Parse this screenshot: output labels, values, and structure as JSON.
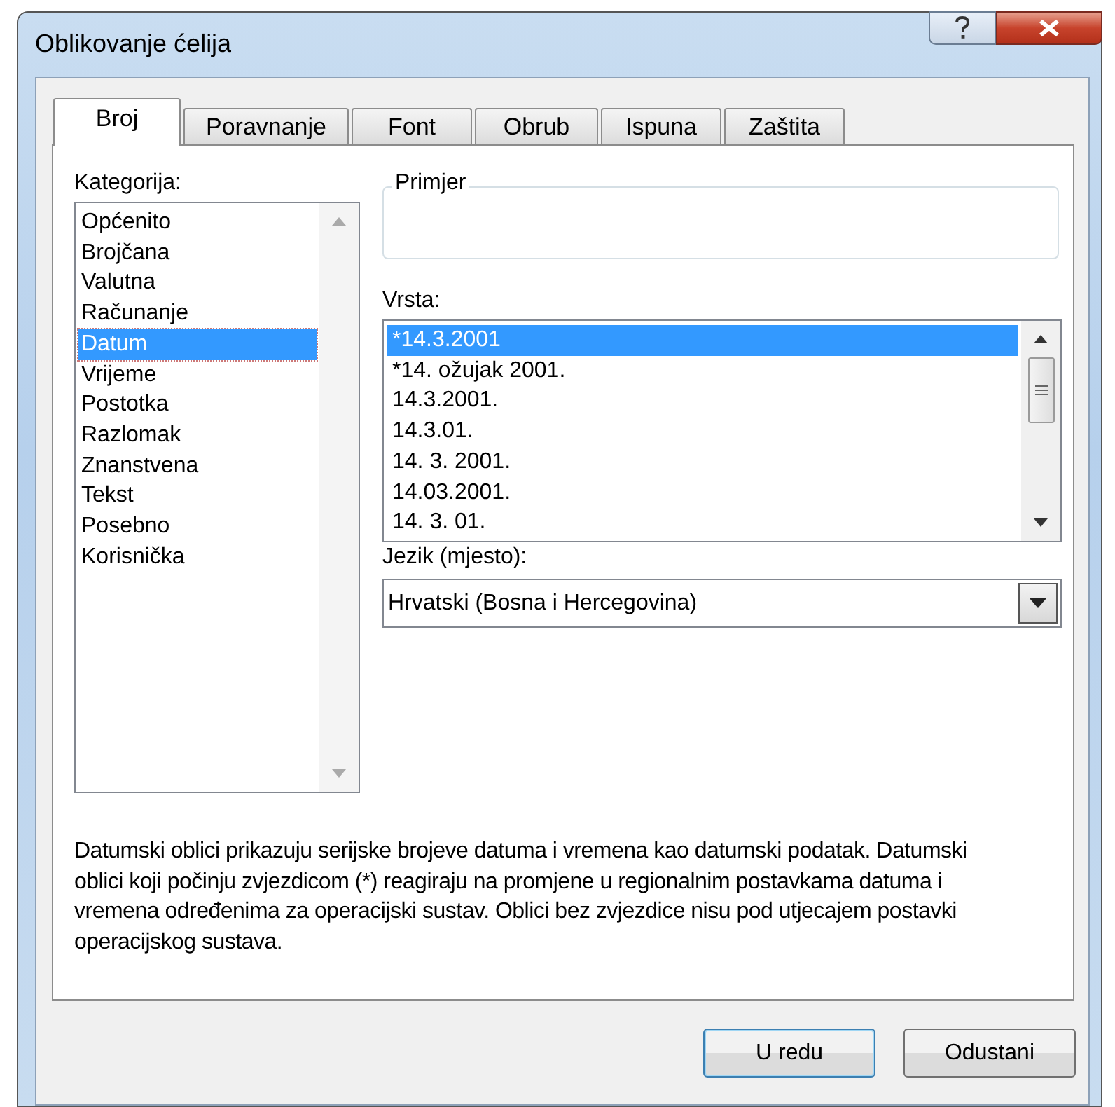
{
  "window": {
    "title": "Oblikovanje ćelija"
  },
  "tabs": [
    {
      "label": "Broj",
      "selected": true
    },
    {
      "label": "Poravnanje",
      "selected": false
    },
    {
      "label": "Font",
      "selected": false
    },
    {
      "label": "Obrub",
      "selected": false
    },
    {
      "label": "Ispuna",
      "selected": false
    },
    {
      "label": "Zaštita",
      "selected": false
    }
  ],
  "category": {
    "label": "Kategorija:",
    "items": [
      {
        "label": "Općenito",
        "selected": false
      },
      {
        "label": "Brojčana",
        "selected": false
      },
      {
        "label": "Valutna",
        "selected": false
      },
      {
        "label": "Računanje",
        "selected": false
      },
      {
        "label": "Datum",
        "selected": true
      },
      {
        "label": "Vrijeme",
        "selected": false
      },
      {
        "label": "Postotka",
        "selected": false
      },
      {
        "label": "Razlomak",
        "selected": false
      },
      {
        "label": "Znanstvena",
        "selected": false
      },
      {
        "label": "Tekst",
        "selected": false
      },
      {
        "label": "Posebno",
        "selected": false
      },
      {
        "label": "Korisnička",
        "selected": false
      }
    ]
  },
  "sample": {
    "label": "Primjer"
  },
  "type": {
    "label": "Vrsta:",
    "items": [
      {
        "label": "*14.3.2001",
        "selected": true
      },
      {
        "label": "*14. ožujak 2001.",
        "selected": false
      },
      {
        "label": "14.3.2001.",
        "selected": false
      },
      {
        "label": "14.3.01.",
        "selected": false
      },
      {
        "label": "14. 3. 2001.",
        "selected": false
      },
      {
        "label": "14.03.2001.",
        "selected": false
      },
      {
        "label": "14. 3. 01.",
        "selected": false
      }
    ]
  },
  "locale": {
    "label": "Jezik (mjesto):",
    "value": "Hrvatski (Bosna i Hercegovina)"
  },
  "description": "Datumski oblici prikazuju serijske brojeve datuma i vremena kao datumski podatak. Datumski oblici koji počinju zvjezdicom (*) reagiraju na promjene u regionalnim postavkama datuma i vremena određenima za operacijski sustav. Oblici bez zvjezdice nisu pod utjecajem postavki operacijskog sustava.",
  "buttons": [
    {
      "label": "U redu",
      "default": true
    },
    {
      "label": "Odustani",
      "default": false
    }
  ]
}
